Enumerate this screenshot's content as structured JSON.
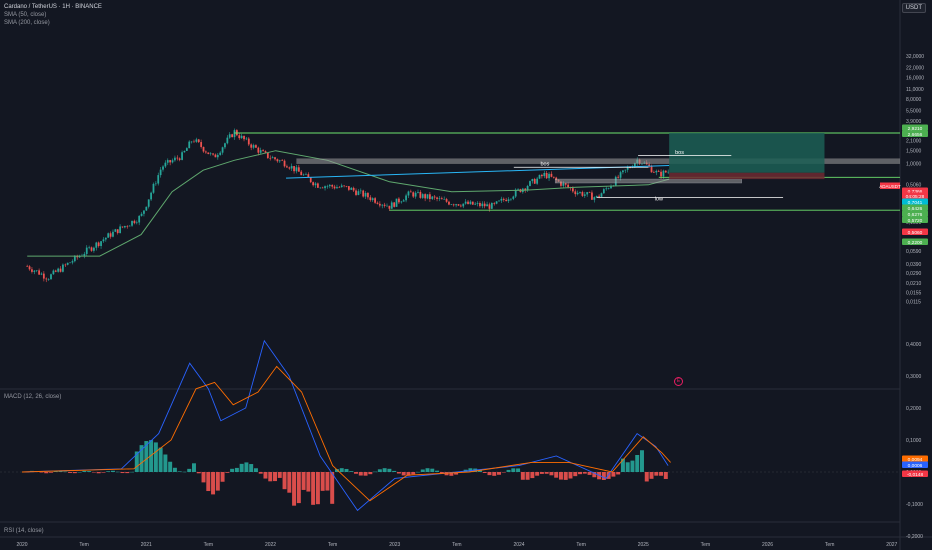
{
  "header": {
    "symbol_line": "Cardano / TetherUS · 1H · BINANCE",
    "sma50": "SMA (50, close)",
    "sma200": "SMA (200, close)",
    "macd": "MACD (12, 26, close)",
    "rsi": "RSI (14, close)"
  },
  "currency": "USDT",
  "events_icon": "calendar-event-icon",
  "colors": {
    "bg": "#131722",
    "up": "#26a69a",
    "down": "#ef5350",
    "sma50": "#5fa86e",
    "level": "#6ee46e",
    "zone": "#9e9e9e",
    "trendline": "#29b6f6",
    "macd": "#2962ff",
    "signal": "#ff6d00",
    "target_zone": "#1c5f55",
    "stop_zone": "#6e2a31"
  },
  "chart_data": [
    {
      "type": "candlestick",
      "scale": "log",
      "y_ticks": [
        "32,0000",
        "22,0000",
        "16,0000",
        "11,0000",
        "8,0000",
        "5,5000",
        "3,9000",
        "2,8000",
        "2,1000",
        "1,5000",
        "1,0000",
        "0,5060",
        "0,3500",
        "0,2500",
        "0,1500",
        "0,1100",
        "0,0800",
        "0,0590",
        "0,0390",
        "0,0290",
        "0,0210",
        "0,0155",
        "0,0115"
      ],
      "x_ticks": [
        "2020",
        "Tem",
        "2021",
        "Tem",
        "2022",
        "Tem",
        "2023",
        "Tem",
        "2024",
        "Tem",
        "2025",
        "Tem",
        "2026",
        "Tem",
        "2027"
      ],
      "price_path": [
        [
          "2020-01",
          0.036
        ],
        [
          "2020-03",
          0.025
        ],
        [
          "2020-06",
          0.05
        ],
        [
          "2020-09",
          0.1
        ],
        [
          "2020-12",
          0.18
        ],
        [
          "2021-02",
          0.9
        ],
        [
          "2021-04",
          1.3
        ],
        [
          "2021-05",
          2.2
        ],
        [
          "2021-07",
          1.2
        ],
        [
          "2021-09",
          2.8
        ],
        [
          "2021-10",
          2.1
        ],
        [
          "2021-12",
          1.3
        ],
        [
          "2022-02",
          1.0
        ],
        [
          "2022-05",
          0.5
        ],
        [
          "2022-08",
          0.45
        ],
        [
          "2022-12",
          0.25
        ],
        [
          "2023-02",
          0.38
        ],
        [
          "2023-06",
          0.28
        ],
        [
          "2023-10",
          0.25
        ],
        [
          "2024-03",
          0.7
        ],
        [
          "2024-06",
          0.4
        ],
        [
          "2024-08",
          0.33
        ],
        [
          "2024-12",
          1.15
        ],
        [
          "2025-02",
          0.7
        ],
        [
          "2025-03",
          0.78
        ]
      ],
      "sma200_path": [
        [
          "2020-01",
          0.05
        ],
        [
          "2020-08",
          0.05
        ],
        [
          "2020-12",
          0.1
        ],
        [
          "2021-03",
          0.4
        ],
        [
          "2021-06",
          0.8
        ],
        [
          "2021-09",
          1.1
        ],
        [
          "2022-01",
          1.5
        ],
        [
          "2022-06",
          1.1
        ],
        [
          "2022-12",
          0.55
        ],
        [
          "2023-06",
          0.4
        ],
        [
          "2024-01",
          0.42
        ],
        [
          "2024-06",
          0.46
        ],
        [
          "2025-01",
          0.5
        ],
        [
          "2025-03",
          0.6
        ]
      ],
      "labels": [
        {
          "text": "bos",
          "date": "2024-03",
          "price": 0.93
        },
        {
          "text": "bos",
          "date": "2025-04",
          "price": 1.35
        },
        {
          "text": "low",
          "date": "2025-02",
          "price": 0.3
        }
      ],
      "price_badges": [
        {
          "text": "2,9210",
          "color": "#4caf50"
        },
        {
          "text": "2,6656",
          "color": "#4caf50"
        },
        {
          "text": "ADAUSDT",
          "color": "#f23645"
        },
        {
          "text": "0,7366",
          "color": "#f23645"
        },
        {
          "text": "04:05:28",
          "color": "#f23645"
        },
        {
          "text": "0,7041",
          "color": "#00bcd4"
        },
        {
          "text": "0,6426",
          "color": "#4caf50"
        },
        {
          "text": "0,6276",
          "color": "#4caf50"
        },
        {
          "text": "0,5720",
          "color": "#4caf50"
        },
        {
          "text": "0,5060",
          "color": "#f23645"
        },
        {
          "text": "0,2200",
          "color": "#4caf50"
        }
      ]
    },
    {
      "type": "macd",
      "y_ticks": [
        "0,4000",
        "0,3000",
        "0,2000",
        "0,1000",
        "0,0000",
        "-0,1000",
        "-0,2000",
        "-0,3000"
      ],
      "badges": [
        {
          "text": "0,0094",
          "color": "#ff6d00"
        },
        {
          "text": "0,0006",
          "color": "#2962ff"
        },
        {
          "text": "-0,0148",
          "color": "#f23645"
        }
      ]
    }
  ]
}
